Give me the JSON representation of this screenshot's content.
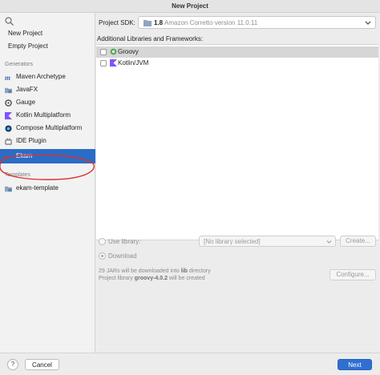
{
  "window": {
    "title": "New Project"
  },
  "sidebar": {
    "search_icon": "search-icon",
    "top_items": [
      {
        "label": "New Project"
      },
      {
        "label": "Empty Project"
      }
    ],
    "generators_header": "Generators",
    "generators": [
      {
        "label": "Maven Archetype",
        "icon": "maven-icon"
      },
      {
        "label": "JavaFX",
        "icon": "javafx-folder-icon"
      },
      {
        "label": "Gauge",
        "icon": "gauge-icon"
      },
      {
        "label": "Kotlin Multiplatform",
        "icon": "kotlin-icon"
      },
      {
        "label": "Compose Multiplatform",
        "icon": "compose-icon"
      },
      {
        "label": "IDE Plugin",
        "icon": "plugin-icon"
      },
      {
        "label": "Ekam",
        "icon": "none",
        "selected": true
      }
    ],
    "templates_header": "Templates",
    "templates": [
      {
        "label": "ekam-template",
        "icon": "template-folder-icon"
      }
    ]
  },
  "main": {
    "sdk_label": "Project SDK:",
    "sdk_version": "1.8",
    "sdk_description": "Amazon Corretto version 11.0.11",
    "libraries_label": "Additional Libraries and Frameworks:",
    "libraries": [
      {
        "name": "Groovy",
        "selected": true
      },
      {
        "name": "Kotlin/JVM",
        "selected": false
      }
    ],
    "use_library_label": "Use library:",
    "library_placeholder": "[No library selected]",
    "create_button": "Create...",
    "download_label": "Download",
    "download_note_prefix": "29 JARs will be downloaded into",
    "download_note_dir": "lib",
    "download_note_suffix": "directory",
    "library_note_prefix": "Project library",
    "library_note_name": "groovy-4.0.2",
    "library_note_suffix": "will be created",
    "configure_button": "Configure..."
  },
  "footer": {
    "help_label": "?",
    "cancel_button": "Cancel",
    "next_button": "Next"
  },
  "colors": {
    "selection": "#2a6cc6",
    "primary_button": "#2f6fd1",
    "annotation_circle": "#d9322c"
  }
}
